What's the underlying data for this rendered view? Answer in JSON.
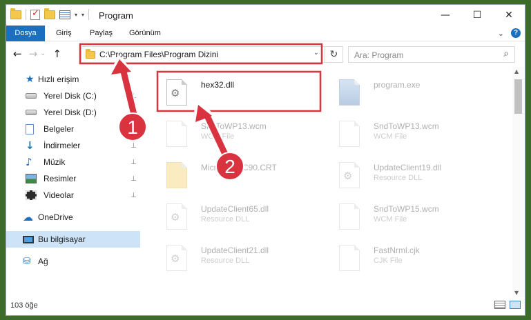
{
  "window": {
    "title": "Program",
    "controls": {
      "minimize": "—",
      "maximize": "☐",
      "close": "✕"
    }
  },
  "quick_access_toolbar": {
    "dropdown": "▾",
    "more": "▾"
  },
  "ribbon": {
    "tabs": [
      "Dosya",
      "Giriş",
      "Paylaş",
      "Görünüm"
    ],
    "expand": "⌄",
    "help": "?"
  },
  "navigation": {
    "back": "←",
    "forward": "→",
    "recent": "⌄",
    "up": "↑",
    "address": "C:\\Program Files\\Program Dizini",
    "address_dropdown": "⌄",
    "refresh": "↻",
    "search_placeholder": "Ara: Program",
    "search_icon": "⌕"
  },
  "sidebar": {
    "items": [
      {
        "label": "Hızlı erişim",
        "icon": "star-icon",
        "pinned": false
      },
      {
        "label": "Yerel Disk (C:)",
        "icon": "disk-icon",
        "pinned": true
      },
      {
        "label": "Yerel Disk (D:)",
        "icon": "disk-icon",
        "pinned": true
      },
      {
        "label": "Belgeler",
        "icon": "document-icon",
        "pinned": true
      },
      {
        "label": "İndirmeler",
        "icon": "download-icon",
        "pinned": true
      },
      {
        "label": "Müzik",
        "icon": "music-icon",
        "pinned": true
      },
      {
        "label": "Resimler",
        "icon": "pictures-icon",
        "pinned": true
      },
      {
        "label": "Videolar",
        "icon": "videos-icon",
        "pinned": true
      },
      {
        "label": "OneDrive",
        "icon": "cloud-icon",
        "pinned": false
      },
      {
        "label": "Bu bilgisayar",
        "icon": "computer-icon",
        "pinned": false,
        "selected": true
      },
      {
        "label": "Ağ",
        "icon": "network-icon",
        "pinned": false
      }
    ],
    "pin_glyph": "📌"
  },
  "files": [
    {
      "name": "hex32.dll",
      "type": "",
      "icon": "dll-gear-icon",
      "highlighted": true
    },
    {
      "name": "program.exe",
      "type": "",
      "icon": "exe-icon",
      "faded": true
    },
    {
      "name": "SndToWP13.wcm",
      "type": "WCM File",
      "icon": "file-icon",
      "faded": true
    },
    {
      "name": "SndToWP13.wcm",
      "type": "WCM File",
      "icon": "file-icon",
      "faded": true
    },
    {
      "name": "Microsoft.VC90.CRT",
      "type": "",
      "icon": "folder-icon",
      "faded": true
    },
    {
      "name": "UpdateClient19.dll",
      "type": "Resource DLL",
      "icon": "dll-gear-icon",
      "faded": true
    },
    {
      "name": "UpdateClient65.dll",
      "type": "Resource DLL",
      "icon": "dll-gear-icon",
      "faded": true
    },
    {
      "name": "SndToWP15.wcm",
      "type": "WCM File",
      "icon": "file-icon",
      "faded": true
    },
    {
      "name": "UpdateClient21.dll",
      "type": "Resource DLL",
      "icon": "dll-gear-icon",
      "faded": true
    },
    {
      "name": "FastNrml.cjk",
      "type": "CJK File",
      "icon": "file-icon",
      "faded": true
    }
  ],
  "annotations": {
    "badge_1": "1",
    "badge_2": "2",
    "highlight_color": "#d9333f"
  },
  "status": {
    "item_count": "103 öğe"
  },
  "colors": {
    "accent": "#1a6fbf",
    "selection": "#cde3f7"
  }
}
